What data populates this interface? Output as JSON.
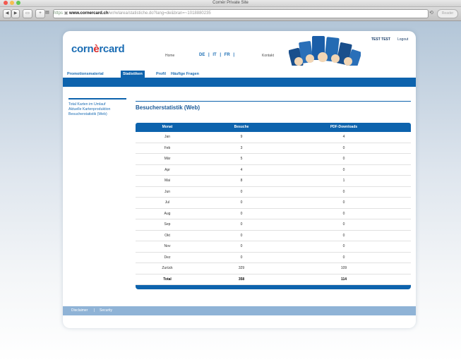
{
  "window": {
    "title": "Cornèr Private Site"
  },
  "browser": {
    "https_label": "https",
    "host": "www.cornercard.ch",
    "path": "/wr/wlarea/statistiche.do?lang=de&bran=~1018880235",
    "reader_label": "Reader",
    "reload_glyph": "⟲"
  },
  "header": {
    "logo_pre": "corn",
    "logo_mark": "è",
    "logo_post": "rcard",
    "nav": {
      "home": "Home",
      "de": "DE",
      "it": "IT",
      "fr": "FR",
      "sep": "|",
      "kontakt": "Kontakt"
    },
    "user": "TEST TEST",
    "logout": "Logout"
  },
  "tabs": [
    "Promotionsmaterial",
    "Statistiken",
    "Profil",
    "Häufige Fragen"
  ],
  "sidebar": [
    "Total Karten im Umlauf",
    "Aktuelle Kartenproduktion",
    "Besucherstatistik (Web)"
  ],
  "page_title": "Besucherstatistik (Web)",
  "table": {
    "headers": [
      "Monat",
      "Besuche",
      "PDF-Downloads"
    ],
    "rows": [
      [
        "Jan",
        "9",
        "4"
      ],
      [
        "Feb",
        "3",
        "0"
      ],
      [
        "Mär",
        "5",
        "0"
      ],
      [
        "Apr",
        "4",
        "0"
      ],
      [
        "Mai",
        "8",
        "1"
      ],
      [
        "Jun",
        "0",
        "0"
      ],
      [
        "Jul",
        "0",
        "0"
      ],
      [
        "Aug",
        "0",
        "0"
      ],
      [
        "Sep",
        "0",
        "0"
      ],
      [
        "Okt",
        "0",
        "0"
      ],
      [
        "Nov",
        "0",
        "0"
      ],
      [
        "Dez",
        "0",
        "0"
      ],
      [
        "Zurück",
        "329",
        "109"
      ]
    ],
    "total": [
      "Total",
      "358",
      "114"
    ]
  },
  "footer": {
    "disclaimer": "Disclaimer",
    "sep": "|",
    "security": "Security"
  },
  "colors": {
    "brand_blue": "#0d63ad",
    "logo_accent": "#d92a2a",
    "footer_blue": "#8fb3d6"
  }
}
